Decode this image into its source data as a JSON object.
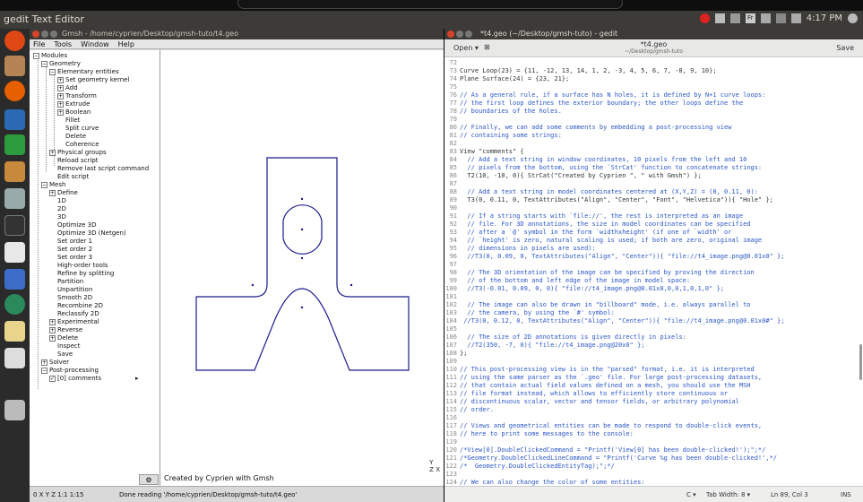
{
  "panel": {
    "app_title": "gedit Text Editor",
    "clock": "4:17 PM"
  },
  "launcher": {
    "icons": [
      "ubuntu-logo-icon",
      "files-icon",
      "firefox-icon",
      "writer-icon",
      "calc-icon",
      "archive-icon",
      "settings-icon",
      "terminal-icon",
      "slack-icon",
      "scaling-icon",
      "globe-icon",
      "text-editor-icon",
      "gmsh-icon",
      "drive-icon"
    ]
  },
  "gmsh": {
    "title": "Gmsh - /home/cyprien/Desktop/gmsh-tuto/t4.geo",
    "menu": [
      "File",
      "Tools",
      "Window",
      "Help"
    ],
    "tree": [
      {
        "label": "Modules",
        "indent": 0,
        "box": "−"
      },
      {
        "label": "Geometry",
        "indent": 1,
        "box": "−"
      },
      {
        "label": "Elementary entities",
        "indent": 2,
        "box": "−"
      },
      {
        "label": "Set geometry kernel",
        "indent": 3,
        "box": "+"
      },
      {
        "label": "Add",
        "indent": 3,
        "box": "+"
      },
      {
        "label": "Transform",
        "indent": 3,
        "box": "+"
      },
      {
        "label": "Extrude",
        "indent": 3,
        "box": "+"
      },
      {
        "label": "Boolean",
        "indent": 3,
        "box": "+"
      },
      {
        "label": "Fillet",
        "indent": 3,
        "box": ""
      },
      {
        "label": "Split curve",
        "indent": 3,
        "box": ""
      },
      {
        "label": "Delete",
        "indent": 3,
        "box": ""
      },
      {
        "label": "Coherence",
        "indent": 3,
        "box": ""
      },
      {
        "label": "Physical groups",
        "indent": 2,
        "box": "+"
      },
      {
        "label": "Reload script",
        "indent": 2,
        "box": ""
      },
      {
        "label": "Remove last script command",
        "indent": 2,
        "box": ""
      },
      {
        "label": "Edit script",
        "indent": 2,
        "box": ""
      },
      {
        "label": "Mesh",
        "indent": 1,
        "box": "−"
      },
      {
        "label": "Define",
        "indent": 2,
        "box": "+"
      },
      {
        "label": "1D",
        "indent": 2,
        "box": ""
      },
      {
        "label": "2D",
        "indent": 2,
        "box": ""
      },
      {
        "label": "3D",
        "indent": 2,
        "box": ""
      },
      {
        "label": "Optimize 3D",
        "indent": 2,
        "box": ""
      },
      {
        "label": "Optimize 3D (Netgen)",
        "indent": 2,
        "box": ""
      },
      {
        "label": "Set order 1",
        "indent": 2,
        "box": ""
      },
      {
        "label": "Set order 2",
        "indent": 2,
        "box": ""
      },
      {
        "label": "Set order 3",
        "indent": 2,
        "box": ""
      },
      {
        "label": "High-order tools",
        "indent": 2,
        "box": ""
      },
      {
        "label": "Refine by splitting",
        "indent": 2,
        "box": ""
      },
      {
        "label": "Partition",
        "indent": 2,
        "box": ""
      },
      {
        "label": "Unpartition",
        "indent": 2,
        "box": ""
      },
      {
        "label": "Smooth 2D",
        "indent": 2,
        "box": ""
      },
      {
        "label": "Recombine 2D",
        "indent": 2,
        "box": ""
      },
      {
        "label": "Reclassify 2D",
        "indent": 2,
        "box": ""
      },
      {
        "label": "Experimental",
        "indent": 2,
        "box": "+"
      },
      {
        "label": "Reverse",
        "indent": 2,
        "box": "+"
      },
      {
        "label": "Delete",
        "indent": 2,
        "box": "+"
      },
      {
        "label": "Inspect",
        "indent": 2,
        "box": ""
      },
      {
        "label": "Save",
        "indent": 2,
        "box": ""
      },
      {
        "label": "Solver",
        "indent": 1,
        "box": "+"
      },
      {
        "label": "Post-processing",
        "indent": 1,
        "box": "−"
      },
      {
        "label": "[0] comments",
        "indent": 2,
        "box": "✓"
      }
    ],
    "caption": "Created by Cyprien  with Gmsh",
    "axes": {
      "y": "Y",
      "z": "Z",
      "x": "X"
    },
    "gear_label": "⚙",
    "status_left": "0 X Y Z 1:1 1:15",
    "status_msg": "Done reading '/home/cyprien/Desktop/gmsh-tuto/t4.geo'"
  },
  "gedit": {
    "title": "*t4.geo (~/Desktop/gmsh-tuto) - gedit",
    "open_label": "Open ▾",
    "file_name": "*t4.geo",
    "file_path": "~/Desktop/gmsh-tuto",
    "save_label": "Save",
    "status_lang": "C ▾",
    "status_tab": "Tab Width: 8 ▾",
    "status_pos": "Ln 89, Col 3",
    "status_mode": "INS",
    "lines": [
      {
        "n": "72",
        "t": "",
        "k": "c"
      },
      {
        "n": "73",
        "t": "Curve Loop(23) = {11, -12, 13, 14, 1, 2, -3, 4, 5, 6, 7, -8, 9, 10};",
        "k": "k"
      },
      {
        "n": "74",
        "t": "Plane Surface(24) = {23, 21};",
        "k": "k"
      },
      {
        "n": "75",
        "t": "",
        "k": "c"
      },
      {
        "n": "76",
        "t": "// As a general rule, if a surface has N holes, it is defined by N+1 curve loops:",
        "k": "c"
      },
      {
        "n": "77",
        "t": "// the first loop defines the exterior boundary; the other loops define the",
        "k": "c"
      },
      {
        "n": "78",
        "t": "// boundaries of the holes.",
        "k": "c"
      },
      {
        "n": "79",
        "t": "",
        "k": "c"
      },
      {
        "n": "80",
        "t": "// Finally, we can add some comments by embedding a post-processing view",
        "k": "c"
      },
      {
        "n": "81",
        "t": "// containing some strings:",
        "k": "c"
      },
      {
        "n": "82",
        "t": "",
        "k": "c"
      },
      {
        "n": "83",
        "t": "View \"comments\" {",
        "k": "k"
      },
      {
        "n": "84",
        "t": "  // Add a text string in window coordinates, 10 pixels from the left and 10",
        "k": "c"
      },
      {
        "n": "85",
        "t": "  // pixels from the bottom, using the `StrCat' function to concatenate strings:",
        "k": "c"
      },
      {
        "n": "86",
        "t": "  T2(10, -10, 0){ StrCat(\"Created by Cyprien \", \" with Gmsh\") };",
        "k": "k"
      },
      {
        "n": "87",
        "t": "",
        "k": "c"
      },
      {
        "n": "88",
        "t": "  // Add a text string in model coordinates centered at (X,Y,Z) = (0, 0.11, 0):",
        "k": "c"
      },
      {
        "n": "89",
        "t": "  T3(0, 0.11, 0, TextAttributes(\"Align\", \"Center\", \"Font\", \"Helvetica\")){ \"Hole\" };",
        "k": "k"
      },
      {
        "n": "90",
        "t": "",
        "k": "c"
      },
      {
        "n": "91",
        "t": "  // If a string starts with `file://', the rest is interpreted as an image",
        "k": "c"
      },
      {
        "n": "92",
        "t": "  // file. For 3D annotations, the size in model coordinates can be specified",
        "k": "c"
      },
      {
        "n": "93",
        "t": "  // after a `@' symbol in the form `widthxheight' (if one of `width' or",
        "k": "c"
      },
      {
        "n": "94",
        "t": "  // `height' is zero, natural scaling is used; if both are zero, original image",
        "k": "c"
      },
      {
        "n": "95",
        "t": "  // dimensions in pixels are used):",
        "k": "c"
      },
      {
        "n": "96",
        "t": "  //T3(0, 0.09, 0, TextAttributes(\"Align\", \"Center\")){ \"file://t4_image.png@0.01x0\" };",
        "k": "c"
      },
      {
        "n": "97",
        "t": "",
        "k": "c"
      },
      {
        "n": "98",
        "t": "  // The 3D orientation of the image can be specified by proving the direction",
        "k": "c"
      },
      {
        "n": "99",
        "t": "  // of the bottom and left edge of the image in model space:",
        "k": "c"
      },
      {
        "n": "100",
        "t": "  //T3(-0.01, 0.09, 0, 0){ \"file://t4_image.png@0.01x0,0,0,1,0,1,0\" };",
        "k": "c"
      },
      {
        "n": "101",
        "t": "",
        "k": "c"
      },
      {
        "n": "102",
        "t": "  // The image can also be drawn in \"billboard\" mode, i.e. always parallel to",
        "k": "c"
      },
      {
        "n": "103",
        "t": "  // the camera, by using the `#' symbol:",
        "k": "c"
      },
      {
        "n": "104",
        "t": " //T3(0, 0.12, 0, TextAttributes(\"Align\", \"Center\")){ \"file://t4_image.png@0.01x0#\" };",
        "k": "c"
      },
      {
        "n": "105",
        "t": "",
        "k": "c"
      },
      {
        "n": "106",
        "t": "  // The size of 2D annotations is given directly in pixels:",
        "k": "c"
      },
      {
        "n": "107",
        "t": "  //T2(350, -7, 0){ \"file://t4_image.png@20x0\" };",
        "k": "c"
      },
      {
        "n": "108",
        "t": "};",
        "k": "k"
      },
      {
        "n": "109",
        "t": "",
        "k": "c"
      },
      {
        "n": "110",
        "t": "// This post-processing view is in the \"parsed\" format, i.e. it is interpreted",
        "k": "c"
      },
      {
        "n": "111",
        "t": "// using the same parser as the `.geo' file. For large post-processing datasets,",
        "k": "c"
      },
      {
        "n": "112",
        "t": "// that contain actual field values defined on a mesh, you should use the MSH",
        "k": "c"
      },
      {
        "n": "113",
        "t": "// file format instead, which allows to efficiently store continuous or",
        "k": "c"
      },
      {
        "n": "114",
        "t": "// discontinuous scalar, vector and tensor fields, or arbitrary polynomial",
        "k": "c"
      },
      {
        "n": "115",
        "t": "// order.",
        "k": "c"
      },
      {
        "n": "116",
        "t": "",
        "k": "c"
      },
      {
        "n": "117",
        "t": "// Views and geometrical entities can be made to respond to double-click events,",
        "k": "c"
      },
      {
        "n": "118",
        "t": "// here to print some messages to the console:",
        "k": "c"
      },
      {
        "n": "119",
        "t": "",
        "k": "c"
      },
      {
        "n": "120",
        "t": "/*View[0].DoubleClickedCommand = \"Printf('View[0] has been double-clicked!');\";*/",
        "k": "c"
      },
      {
        "n": "121",
        "t": "/*Geometry.DoubleClickedLineCommand = \"Printf('Curve %g has been double-clicked!',*/",
        "k": "c"
      },
      {
        "n": "122",
        "t": "/*  Geometry.DoubleClickedEntityTag);\";*/",
        "k": "c"
      },
      {
        "n": "123",
        "t": "",
        "k": "c"
      },
      {
        "n": "124",
        "t": "// We can also change the color of some entities:",
        "k": "c"
      }
    ]
  },
  "colors": {
    "ubuntu_panel": "#3c3b37",
    "launcher": "#2b2b2b",
    "comment": "#2b57c8",
    "string": "#c4006b",
    "geometry_line": "#1a1a8c"
  }
}
